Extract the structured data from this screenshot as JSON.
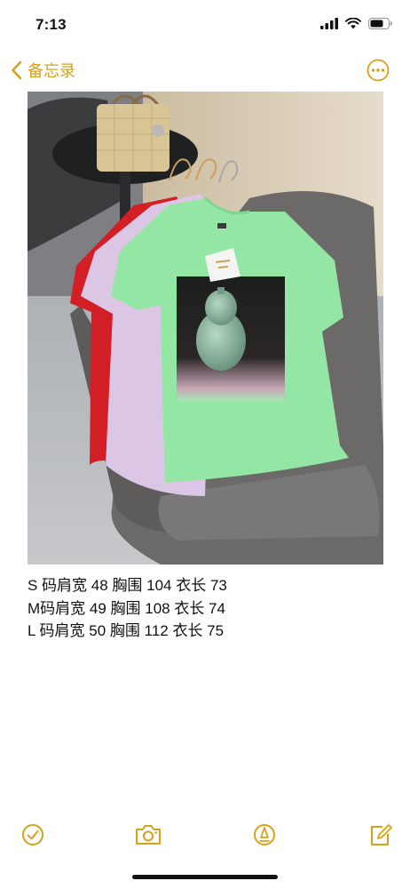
{
  "status_bar": {
    "time": "7:13",
    "icons": [
      "cellular-signal-icon",
      "wifi-icon",
      "battery-icon"
    ]
  },
  "nav": {
    "back_label": "备忘录",
    "back_icon": "chevron-left-icon",
    "more_icon": "ellipsis-circle-icon",
    "accent_color": "#d6a21c"
  },
  "note": {
    "photo_subject": "t-shirt-photo",
    "lines": [
      "S 码肩宽 48 胸围 104 衣长 73",
      "M码肩宽 49 胸围 108 衣长 74",
      "L 码肩宽 50 胸围 112 衣长 75"
    ]
  },
  "toolbar": {
    "icons": [
      "checklist-icon",
      "camera-icon",
      "markup-icon",
      "compose-icon"
    ]
  }
}
